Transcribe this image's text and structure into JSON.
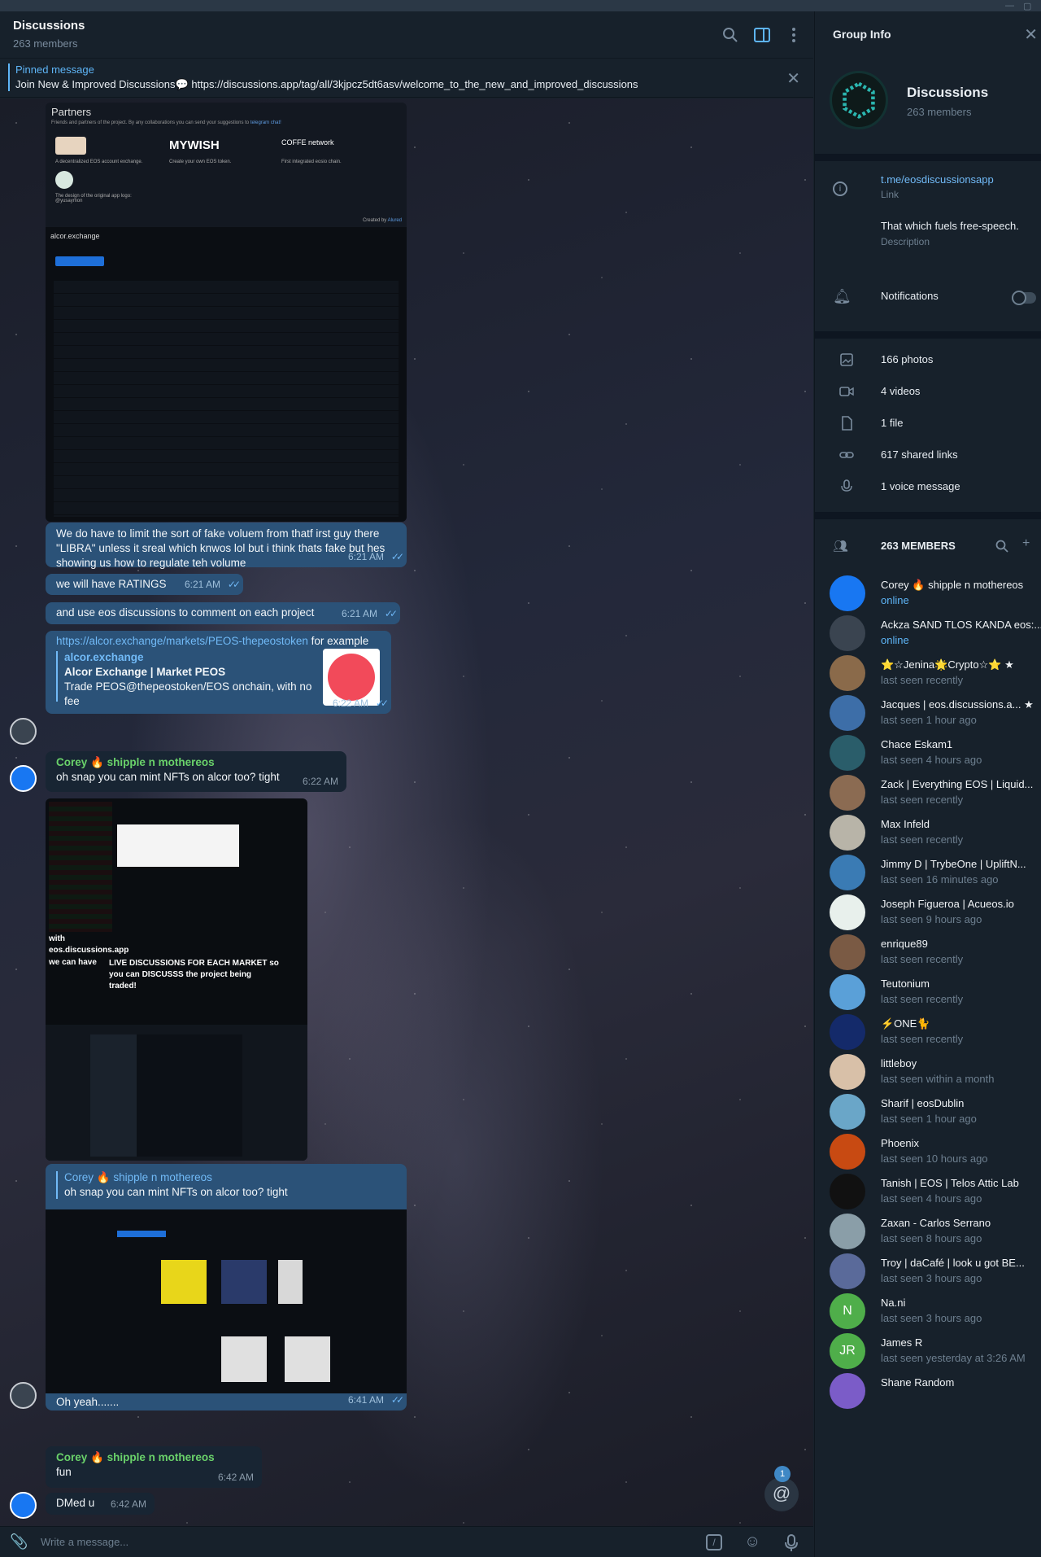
{
  "header": {
    "title": "Discussions",
    "subtitle": "263 members"
  },
  "pinned": {
    "label": "Pinned message",
    "text": "Join New & Improved Discussions💬 https://discussions.app/tag/all/3kjpcz5dt6asv/welcome_to_the_new_and_improved_discussions"
  },
  "messages": {
    "partners": {
      "heading": "Partners",
      "sub": "Friends and partners of the project. By any collaborations you can send your suggestions to",
      "sub_link": "telegram chat!",
      "p1": "A decentralized EOS account exchange.",
      "p2_logo": "MYWISH",
      "p2": "Create your own EOS token.",
      "p3_logo": "COFFE network",
      "p3": "First integrated eosio chain.",
      "p4": "The design of the original app logo: @yusaymon",
      "created": "Created by",
      "created_link": "Alured",
      "alcor_brand": "alcor.exchange"
    },
    "m1": {
      "text": "We do have to limit the sort of fake voluem from thatf irst guy there \"LIBRA\" unless it sreal which knwos lol but i think thats fake but hes showing us how to regulate teh volume",
      "time": "6:21 AM"
    },
    "m2": {
      "text": "we will have RATINGS",
      "time": "6:21 AM"
    },
    "m3": {
      "text": "and use eos discussions to comment on each project",
      "time": "6:21 AM"
    },
    "m4": {
      "link": "https://alcor.exchange/markets/PEOS-thepeostoken",
      "after": " for example",
      "site": "alcor.exchange",
      "title": "Alcor Exchange | Market PEOS",
      "desc": "Trade PEOS@thepeostoken/EOS onchain, with no fee",
      "time": "6:22 AM"
    },
    "m5": {
      "sender": "Corey 🔥 shipple n mothereos",
      "text": "oh snap you can mint NFTs on alcor too?  tight",
      "time": "6:22 AM"
    },
    "img2": {
      "with": "with",
      "site": "eos.discussions.app",
      "can": "we can have",
      "live": "LIVE DISCUSSIONS FOR EACH MARKET so you can DISCUSSS the project being traded!"
    },
    "m6": {
      "reply_sender": "Corey 🔥 shipple n mothereos",
      "reply_text": "oh snap you can mint NFTs on alcor too?  tight",
      "text": "Oh yeah.......",
      "time": "6:41 AM"
    },
    "m7": {
      "sender": "Corey 🔥 shipple n mothereos",
      "text": "fun",
      "time": "6:42 AM"
    },
    "m8": {
      "text": "DMed u",
      "time": "6:42 AM"
    }
  },
  "mention_badge": "1",
  "composer": {
    "placeholder": "Write a message..."
  },
  "group_info": {
    "title": "Group Info",
    "name": "Discussions",
    "members": "263 members",
    "link": "t.me/eosdiscussionsapp",
    "link_label": "Link",
    "description": "That which fuels free-speech.",
    "description_label": "Description",
    "notifications": "Notifications",
    "media": [
      "166 photos",
      "4 videos",
      "1 file",
      "617 shared links",
      "1 voice message"
    ],
    "members_header": "263 MEMBERS"
  },
  "members": [
    {
      "name": "Corey 🔥 shipple n mothereos",
      "status": "online",
      "color": "#1877f2"
    },
    {
      "name": "Ackza SAND TLOS KANDA eos:...",
      "status": "online",
      "color": "#3a4450"
    },
    {
      "name": "⭐☆Jenina🌟Crypto☆⭐ ★",
      "status": "last seen recently",
      "color": "#8a6a4a"
    },
    {
      "name": "Jacques | eos.discussions.a... ★",
      "status": "last seen 1 hour ago",
      "color": "#3d6ea8"
    },
    {
      "name": "Chace Eskam1",
      "status": "last seen 4 hours ago",
      "color": "#2a5d6a"
    },
    {
      "name": "Zack | Everything EOS | Liquid...",
      "status": "last seen recently",
      "color": "#8b6b52"
    },
    {
      "name": "Max Infeld",
      "status": "last seen recently",
      "color": "#b8b4a8"
    },
    {
      "name": "Jimmy D | TrybeOne | UpliftN...",
      "status": "last seen 16 minutes ago",
      "color": "#3a7bb4"
    },
    {
      "name": "Joseph Figueroa | Acueos.io",
      "status": "last seen 9 hours ago",
      "color": "#e8f0ec"
    },
    {
      "name": "enrique89",
      "status": "last seen recently",
      "color": "#7a5a44"
    },
    {
      "name": "Teutonium",
      "status": "last seen recently",
      "color": "#5aa0d8"
    },
    {
      "name": "⚡ONE🐈",
      "status": "last seen recently",
      "color": "#142a6a"
    },
    {
      "name": "littleboy",
      "status": "last seen within a month",
      "color": "#d8c0a8"
    },
    {
      "name": "Sharif | eosDublin",
      "status": "last seen 1 hour ago",
      "color": "#6aa6c8"
    },
    {
      "name": "Phoenix",
      "status": "last seen 10 hours ago",
      "color": "#c84a12"
    },
    {
      "name": "Tanish | EOS | Telos Attic Lab",
      "status": "last seen 4 hours ago",
      "color": "#111111"
    },
    {
      "name": "Zaxan - Carlos Serrano",
      "status": "last seen 8 hours ago",
      "color": "#8a9ea8"
    },
    {
      "name": "Troy | daCafé | look u got BE...",
      "status": "last seen 3 hours ago",
      "color": "#5a6a9a"
    },
    {
      "name": "Na.ni",
      "status": "last seen 3 hours ago",
      "color": "#4fae4a",
      "initials": "N"
    },
    {
      "name": "James R",
      "status": "last seen yesterday at 3:26 AM",
      "color": "#4fae4a",
      "initials": "JR"
    },
    {
      "name": "Shane Random",
      "status": "",
      "color": "#7b5cc8"
    }
  ]
}
